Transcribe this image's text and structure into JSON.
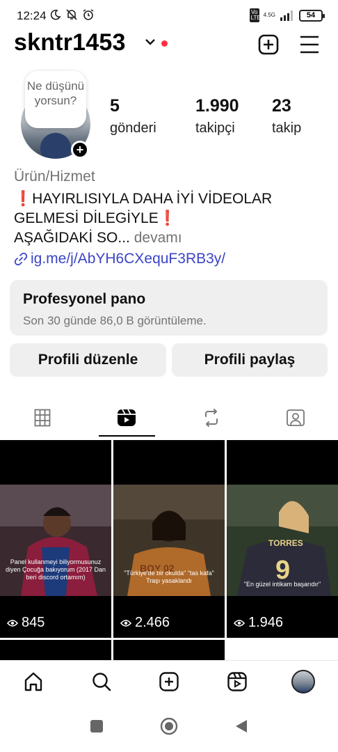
{
  "status_bar": {
    "time": "12:24",
    "network": "4.5G",
    "volte": "Vo LTE",
    "battery": "54"
  },
  "header": {
    "username": "skntr1453"
  },
  "note": {
    "text": "Ne düşünü yorsun?"
  },
  "stats": [
    {
      "value": "5",
      "label": "gönderi"
    },
    {
      "value": "1.990",
      "label": "takipçi"
    },
    {
      "value": "23",
      "label": "takip"
    }
  ],
  "profile": {
    "category": "Ürün/Hizmet",
    "bio_line1": "❗HAYIRLISIYLA DAHA İYİ VİDEOLAR",
    "bio_line2": "GELMESİ DİLEGİYLE❗",
    "bio_line3": "AŞAĞIDAKİ SO...",
    "bio_more": "devamı",
    "link": "ig.me/j/AbYH6CXequF3RB3y/"
  },
  "dashboard": {
    "title": "Profesyonel pano",
    "subtitle": "Son 30 günde 86,0 B görüntüleme."
  },
  "buttons": {
    "edit": "Profili düzenle",
    "share": "Profili paylaş"
  },
  "tabs": [
    "grid-icon",
    "reels-icon",
    "reposts-icon",
    "tagged-icon"
  ],
  "reels": [
    {
      "caption": "Panel kullanmeyi biliyormusunuz diyen Çocuğa bakıyorum (2017 Dan beri discord ortamım)",
      "views": "845"
    },
    {
      "caption": "\"Türkiye'de bir okulda\" \"tas kafa\" Traşı yasaklandı",
      "views": "2.466"
    },
    {
      "caption": "\"En güzel intikam başarıdır\"",
      "views": "1.946"
    }
  ],
  "colors": {
    "link": "#3b44c6",
    "notification_dot": "#ff3040",
    "secondary_text": "#737373",
    "button_bg": "#efefef"
  }
}
